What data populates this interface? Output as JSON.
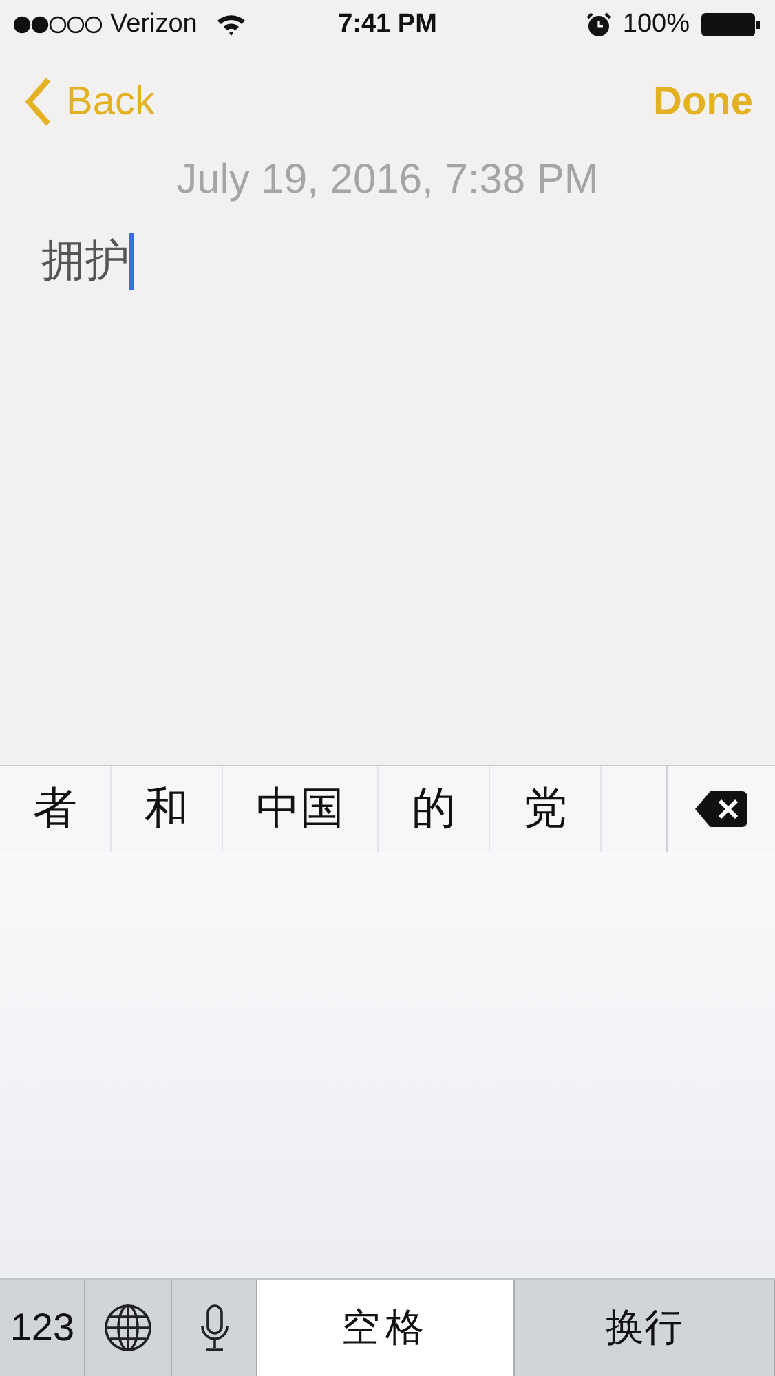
{
  "status_bar": {
    "carrier": "Verizon",
    "time": "7:41 PM",
    "battery": "100%"
  },
  "nav": {
    "back": "Back",
    "done": "Done"
  },
  "note": {
    "date": "July 19, 2016, 7:38 PM",
    "text": "拥护"
  },
  "candidates": [
    "者",
    "和",
    "中国",
    "的",
    "党"
  ],
  "keyboard": {
    "numbers_key": "123",
    "space_key": "空格",
    "return_key": "换行"
  }
}
